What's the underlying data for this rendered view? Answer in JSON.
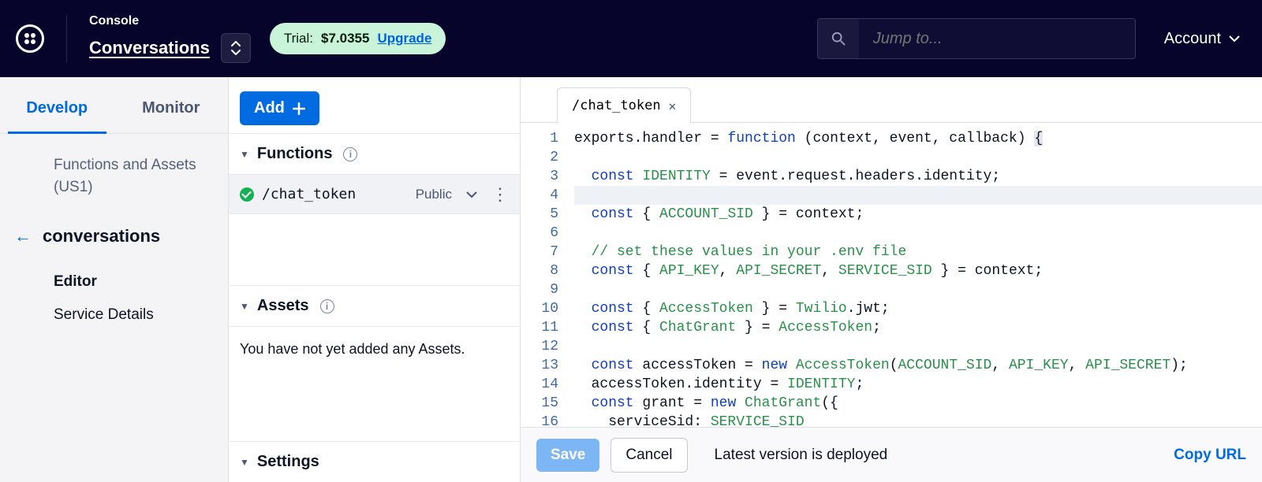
{
  "header": {
    "console_label": "Console",
    "product_name": "Conversations",
    "trial_prefix": "Trial: ",
    "trial_amount": "$7.0355",
    "upgrade_label": "Upgrade",
    "search_placeholder": "Jump to...",
    "account_label": "Account"
  },
  "nav": {
    "tab_develop": "Develop",
    "tab_monitor": "Monitor",
    "functions_assets_label": "Functions and Assets (US1)",
    "back_title": "conversations",
    "item_editor": "Editor",
    "item_service_details": "Service Details"
  },
  "middle": {
    "add_label": "Add",
    "section_functions": "Functions",
    "function_path": "/chat_token",
    "function_visibility": "Public",
    "section_assets": "Assets",
    "assets_empty": "You have not yet added any Assets.",
    "section_settings": "Settings"
  },
  "editor": {
    "tab_name": "/chat_token",
    "gutter": [
      "1",
      "2",
      "3",
      "4",
      "5",
      "6",
      "7",
      "8",
      "9",
      "10",
      "11",
      "12",
      "13",
      "14",
      "15",
      "16"
    ],
    "code": {
      "l1_a": "exports.handler = ",
      "l1_b": "function",
      "l1_c": " (context, event, callback) ",
      "l1_d": "{",
      "l3_a": "  const",
      "l3_b": " IDENTITY",
      "l3_c": " = event.request.headers.identity;",
      "l5_a": "  const",
      "l5_b": " { ",
      "l5_c": "ACCOUNT_SID",
      "l5_d": " } = context;",
      "l7": "  // set these values in your .env file",
      "l8_a": "  const",
      "l8_b": " { ",
      "l8_c": "API_KEY",
      "l8_d": ", ",
      "l8_e": "API_SECRET",
      "l8_f": ", ",
      "l8_g": "SERVICE_SID",
      "l8_h": " } = context;",
      "l10_a": "  const",
      "l10_b": " { ",
      "l10_c": "AccessToken",
      "l10_d": " } = ",
      "l10_e": "Twilio",
      "l10_f": ".jwt;",
      "l11_a": "  const",
      "l11_b": " { ",
      "l11_c": "ChatGrant",
      "l11_d": " } = ",
      "l11_e": "AccessToken",
      "l11_f": ";",
      "l13_a": "  const",
      "l13_b": " accessToken = ",
      "l13_c": "new",
      "l13_d": " AccessToken",
      "l13_e": "(",
      "l13_f": "ACCOUNT_SID",
      "l13_g": ", ",
      "l13_h": "API_KEY",
      "l13_i": ", ",
      "l13_j": "API_SECRET",
      "l13_k": ");",
      "l14_a": "  accessToken.identity = ",
      "l14_b": "IDENTITY",
      "l14_c": ";",
      "l15_a": "  const",
      "l15_b": " grant = ",
      "l15_c": "new",
      "l15_d": " ChatGrant",
      "l15_e": "({",
      "l16_a": "    serviceSid: ",
      "l16_b": "SERVICE_SID"
    },
    "footer": {
      "save": "Save",
      "cancel": "Cancel",
      "status": "Latest version is deployed",
      "copy_url": "Copy URL"
    }
  }
}
